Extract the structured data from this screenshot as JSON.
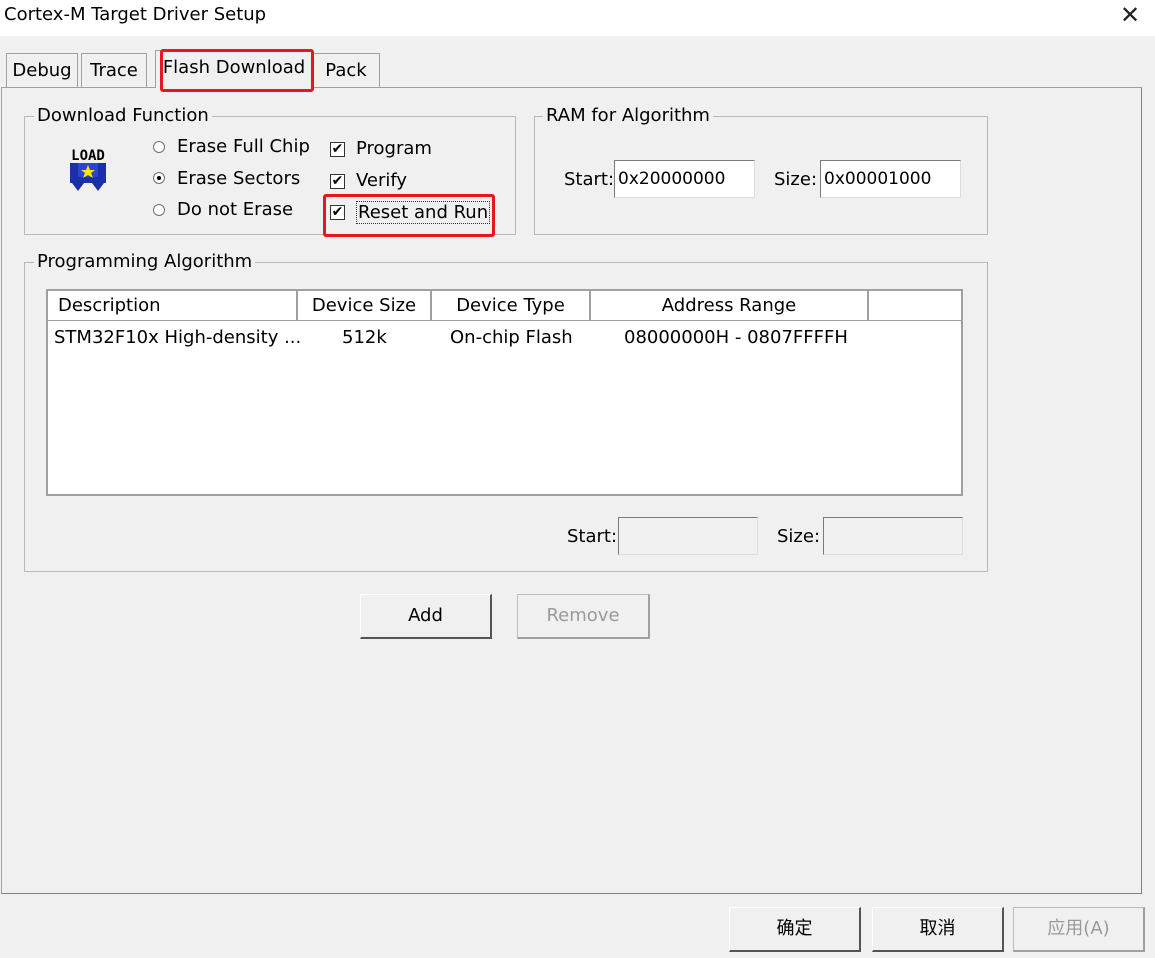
{
  "window": {
    "title": "Cortex-M Target Driver Setup"
  },
  "tabs": [
    {
      "label": "Debug"
    },
    {
      "label": "Trace"
    },
    {
      "label": "Flash Download"
    },
    {
      "label": "Pack"
    }
  ],
  "download_function": {
    "legend": "Download Function",
    "icon_text": "LOAD",
    "erase_options": [
      {
        "label": "Erase Full Chip",
        "selected": false
      },
      {
        "label": "Erase Sectors",
        "selected": true
      },
      {
        "label": "Do not Erase",
        "selected": false
      }
    ],
    "checkboxes": [
      {
        "label": "Program",
        "checked": true
      },
      {
        "label": "Verify",
        "checked": true
      },
      {
        "label": "Reset and Run",
        "checked": true
      }
    ]
  },
  "ram_for_algorithm": {
    "legend": "RAM for Algorithm",
    "start_label": "Start:",
    "start_value": "0x20000000",
    "size_label": "Size:",
    "size_value": "0x00001000"
  },
  "programming_algorithm": {
    "legend": "Programming Algorithm",
    "columns": [
      "Description",
      "Device Size",
      "Device Type",
      "Address Range"
    ],
    "rows": [
      {
        "description": "STM32F10x High-density ...",
        "device_size": "512k",
        "device_type": "On-chip Flash",
        "address_range": "08000000H - 0807FFFFH"
      }
    ],
    "start_label": "Start:",
    "start_value": "",
    "size_label": "Size:",
    "size_value": ""
  },
  "actions": {
    "add_label": "Add",
    "remove_label": "Remove"
  },
  "dialog_buttons": {
    "ok_label": "确定",
    "cancel_label": "取消",
    "apply_label": "应用(A)"
  },
  "colors": {
    "highlight": "#e8171d",
    "background": "#f0f0f0"
  }
}
